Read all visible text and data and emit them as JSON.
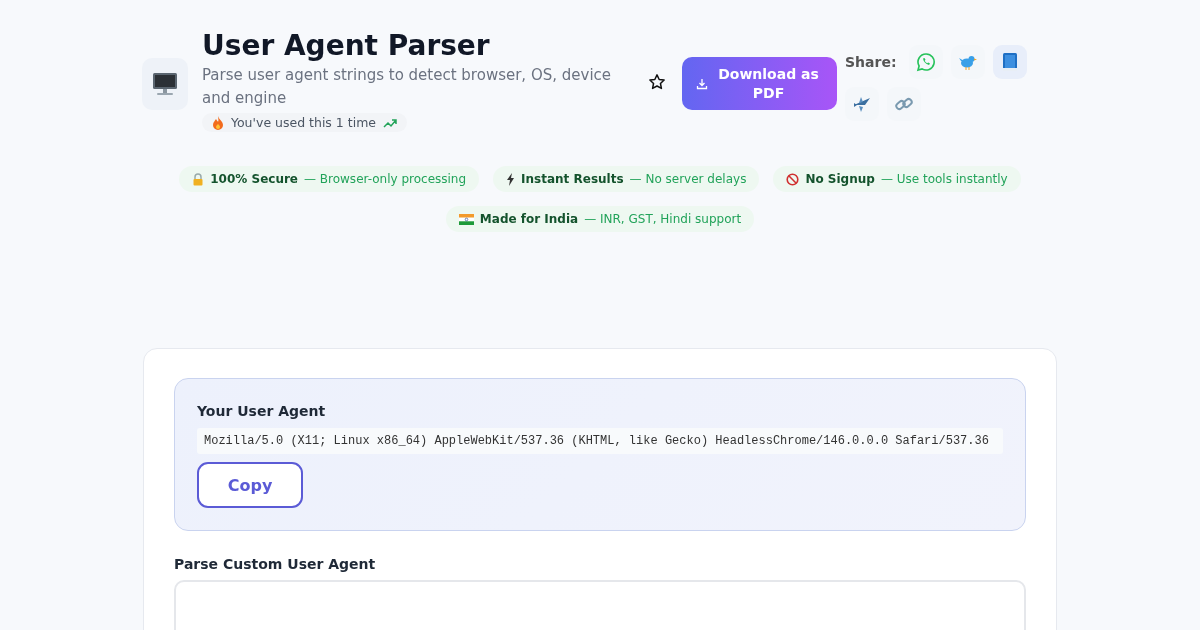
{
  "header": {
    "title": "User Agent Parser",
    "subtitle": "Parse user agent strings to detect browser, OS, device and engine",
    "usage": "You've used this 1 time",
    "download_button": "Download as PDF",
    "share_label": "Share:",
    "share_buttons": [
      {
        "kind": "whatsapp"
      },
      {
        "kind": "twitter"
      },
      {
        "kind": "facebook"
      },
      {
        "kind": "telegram"
      },
      {
        "kind": "link"
      }
    ]
  },
  "badges": [
    {
      "kind": "lock",
      "title": "100% Secure",
      "text": "— Browser-only processing"
    },
    {
      "kind": "bolt",
      "title": "Instant Results",
      "text": "— No server delays"
    },
    {
      "kind": "nosign",
      "title": "No Signup",
      "text": "— Use tools instantly"
    },
    {
      "kind": "flag",
      "title": "Made for India",
      "text": "— INR, GST, Hindi support"
    }
  ],
  "your_agent": {
    "label": "Your User Agent",
    "value": "Mozilla/5.0 (X11; Linux x86_64) AppleWebKit/537.36 (KHTML, like Gecko) HeadlessChrome/146.0.0.0 Safari/537.36",
    "copy_button": "Copy"
  },
  "custom": {
    "label": "Parse Custom User Agent"
  }
}
